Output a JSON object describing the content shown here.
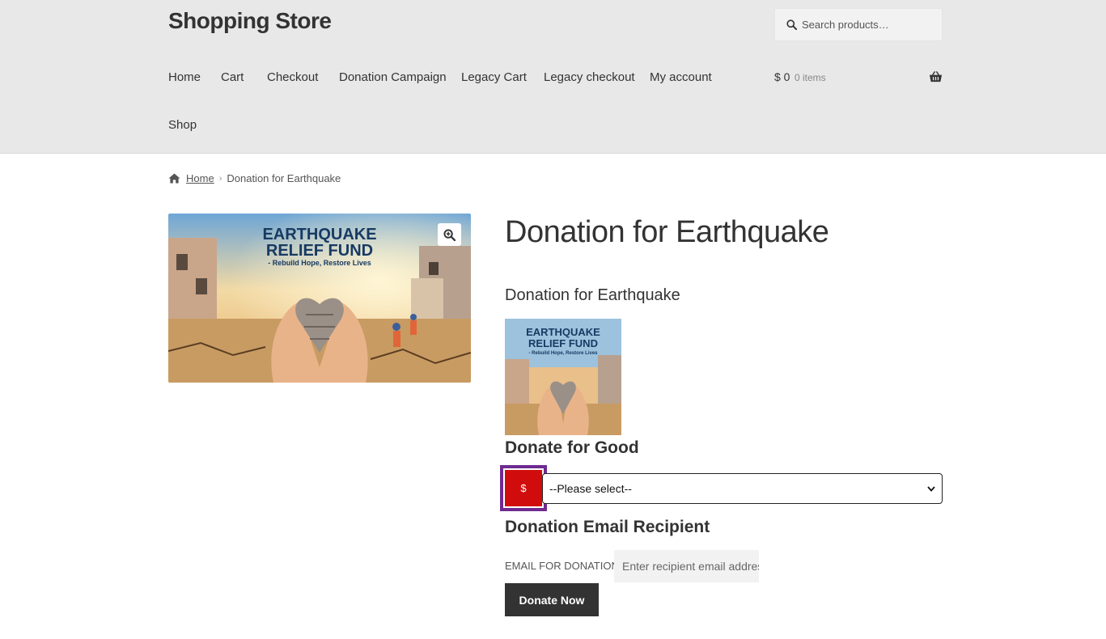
{
  "site": {
    "title": "Shopping Store"
  },
  "search": {
    "placeholder": "Search products…",
    "icon": "search-icon"
  },
  "nav": {
    "items": [
      {
        "label": "Home"
      },
      {
        "label": "Cart"
      },
      {
        "label": "Checkout"
      },
      {
        "label": "Donation Campaign"
      },
      {
        "label": "Legacy Cart"
      },
      {
        "label": "Legacy checkout"
      },
      {
        "label": "My account"
      },
      {
        "label": "Shop"
      }
    ]
  },
  "cart": {
    "total": "$ 0",
    "count": "0 items",
    "icon": "basket-icon"
  },
  "breadcrumb": {
    "home": "Home",
    "current": "Donation for Earthquake"
  },
  "product": {
    "title": "Donation for Earthquake",
    "subtitle": "Donation for Earthquake",
    "image_text": {
      "line1": "EARTHQUAKE",
      "line2": "RELIEF FUND",
      "line3": "- Rebuild Hope, Restore Lives"
    }
  },
  "donate": {
    "heading": "Donate for Good",
    "currency_symbol": "$",
    "select_value": "--Please select--",
    "email_heading": "Donation Email Recipient",
    "email_label": "EMAIL FOR DONATION",
    "email_placeholder": "Enter recipient email address",
    "button_label": "Donate Now"
  },
  "colors": {
    "header_bg": "#e8e8e8",
    "currency_bg": "#d10c0c",
    "focus_outline": "#6f2b90",
    "button_bg": "#333333"
  }
}
